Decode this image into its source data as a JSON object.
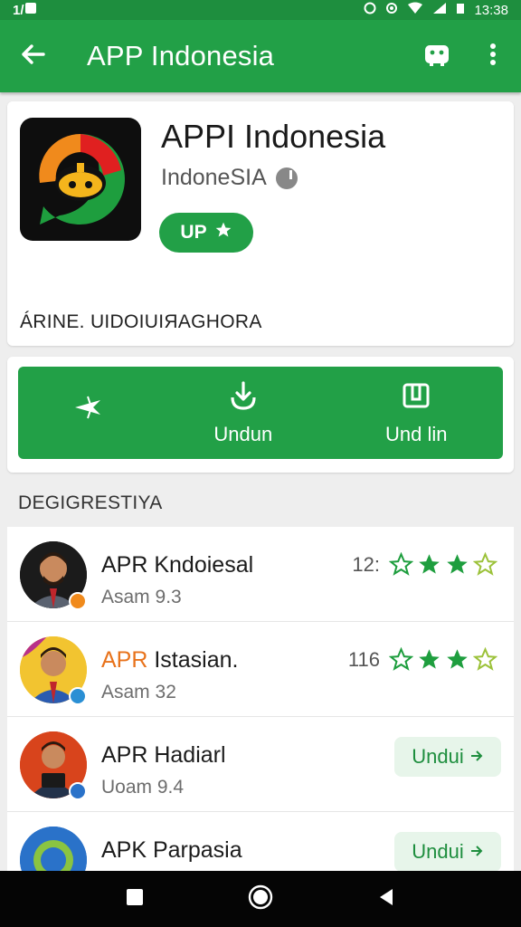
{
  "status_bar": {
    "left_text": "1/",
    "time": "13:38",
    "icons": [
      "alarm-icon",
      "location-icon",
      "wifi-icon",
      "signal-icon",
      "battery-icon"
    ]
  },
  "app_bar": {
    "title": "APP Indonesia",
    "back_icon": "arrow-left-icon",
    "actions": [
      "android-icon",
      "more-vert-icon"
    ]
  },
  "app_detail": {
    "name": "APPI Indonesia",
    "developer": "IndoneSIA",
    "badge_label": "UP",
    "summary": "ÁRINE. UIDOIUIЯAGHORA"
  },
  "action_bar": {
    "buttons": [
      {
        "label": "",
        "icon": "plane-icon"
      },
      {
        "label": "Undun",
        "icon": "download-icon"
      },
      {
        "label": "Und lin",
        "icon": "open-box-icon"
      }
    ]
  },
  "section": {
    "title": "DEGIGRESTIYA"
  },
  "list": {
    "items": [
      {
        "title": "APR Kndoiesal",
        "subtitle": "Asam 9.3",
        "count": "12:",
        "rating": 2,
        "badge_color": "#f08a1c",
        "title_accent": ""
      },
      {
        "title": "APR Istasian.",
        "subtitle": "Asam 32",
        "count": "116",
        "rating": 2,
        "badge_color": "#2a8fd4",
        "title_accent": "APR"
      },
      {
        "title": "APR Hadiarl",
        "subtitle": "Uoam 9.4",
        "button_label": "Undui",
        "badge_color": "#2a72c9",
        "title_accent": ""
      },
      {
        "title": "APK Parpasia",
        "subtitle": "",
        "button_label": "Undui",
        "badge_color": "#2a72c9",
        "title_accent": ""
      }
    ]
  },
  "colors": {
    "primary": "#22a047",
    "primary_dark": "#1e8e3e",
    "star": "#1e9e3e",
    "accent_orange": "#e8731c"
  }
}
